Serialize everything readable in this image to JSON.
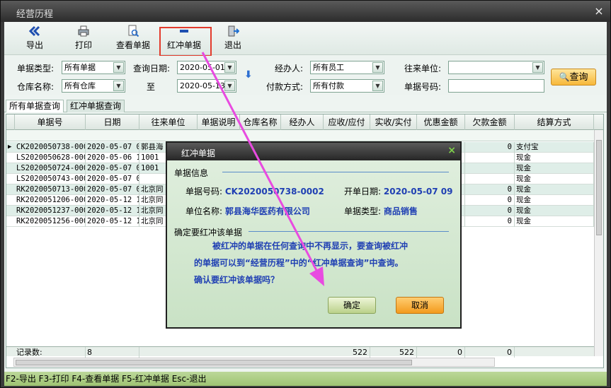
{
  "window": {
    "title": "经营历程",
    "close_icon": "×"
  },
  "toolbar": {
    "export_label": "导出",
    "print_label": "打印",
    "view_label": "查看单据",
    "reverse_label": "红冲单据",
    "exit_label": "退出"
  },
  "filters": {
    "doc_type_label": "单据类型:",
    "doc_type_value": "所有单据",
    "query_date_label": "查询日期:",
    "date_from": "2020-05-01",
    "handler_label": "经办人:",
    "handler_value": "所有员工",
    "partner_label": "往来单位:",
    "partner_value": "",
    "warehouse_label": "仓库名称:",
    "warehouse_value": "所有仓库",
    "to_label": "至",
    "date_to": "2020-05-13",
    "payment_label": "付款方式:",
    "payment_value": "所有付款",
    "doc_no_label": "单据号码:",
    "doc_no_value": "",
    "query_button": "查询"
  },
  "tabs": [
    {
      "label": "所有单据查询",
      "active": true
    },
    {
      "label": "红冲单据查询",
      "active": false
    }
  ],
  "grid": {
    "columns": [
      "单据号",
      "日期",
      "往来单位",
      "单据说明",
      "仓库名称",
      "经办人",
      "应收/应付",
      "实收/实付",
      "优惠金额",
      "欠款金额",
      "结算方式"
    ],
    "rows": [
      {
        "no": "CK2020050738-000",
        "date": "2020-05-07 0",
        "partner": "郭县海",
        "debt": "0",
        "settle": "支付宝"
      },
      {
        "no": "LS2020050628-000",
        "date": "2020-05-06 1",
        "partner": "1001",
        "debt": "",
        "settle": "现金"
      },
      {
        "no": "LS2020050724-000",
        "date": "2020-05-07 0",
        "partner": "1001",
        "debt": "",
        "settle": "现金"
      },
      {
        "no": "LS2020050743-000",
        "date": "2020-05-07 0",
        "partner": "",
        "debt": "",
        "settle": "现金"
      },
      {
        "no": "RK2020050713-000",
        "date": "2020-05-07 0",
        "partner": "北京同",
        "debt": "0",
        "settle": "现金"
      },
      {
        "no": "RK2020051206-000",
        "date": "2020-05-12 1",
        "partner": "北京同",
        "debt": "0",
        "settle": "现金"
      },
      {
        "no": "RK2020051237-000",
        "date": "2020-05-12 1",
        "partner": "北京同",
        "debt": "0",
        "settle": "现金"
      },
      {
        "no": "RK2020051256-000",
        "date": "2020-05-12 1",
        "partner": "北京同",
        "debt": "0",
        "settle": "现金"
      }
    ],
    "summary": {
      "label": "记录数:",
      "count": "8",
      "receivable": "522",
      "received": "522",
      "discount": "0",
      "debt": "0"
    }
  },
  "statusbar": {
    "text": "F2-导出 F3-打印 F4-查看单据 F5-红冲单据 Esc-退出"
  },
  "dialog": {
    "title": "红冲单据",
    "close_icon": "×",
    "info_section": "单据信息",
    "doc_no_label": "单据号码:",
    "doc_no_value": "CK2020050738-0002",
    "open_date_label": "开单日期:",
    "open_date_value": "2020-05-07 09",
    "unit_label": "单位名称:",
    "unit_value": "郭县海华医药有限公司",
    "doc_type_label": "单据类型:",
    "doc_type_value": "商品销售",
    "confirm_section": "确定要红冲该单据",
    "message_line1": "被红冲的单据在任何查询中不再显示，要查询被红冲",
    "message_line2": "的单据可以到“经营历程”中的“红冲单据查询”中查询。",
    "message_line3": "确认要红冲该单据吗？",
    "ok_button": "确定",
    "cancel_button": "取消"
  },
  "colors": {
    "highlight_box": "#e33b2c",
    "annotation_arrow": "#e84be0",
    "dialog_value_text": "#1f3fb3"
  }
}
